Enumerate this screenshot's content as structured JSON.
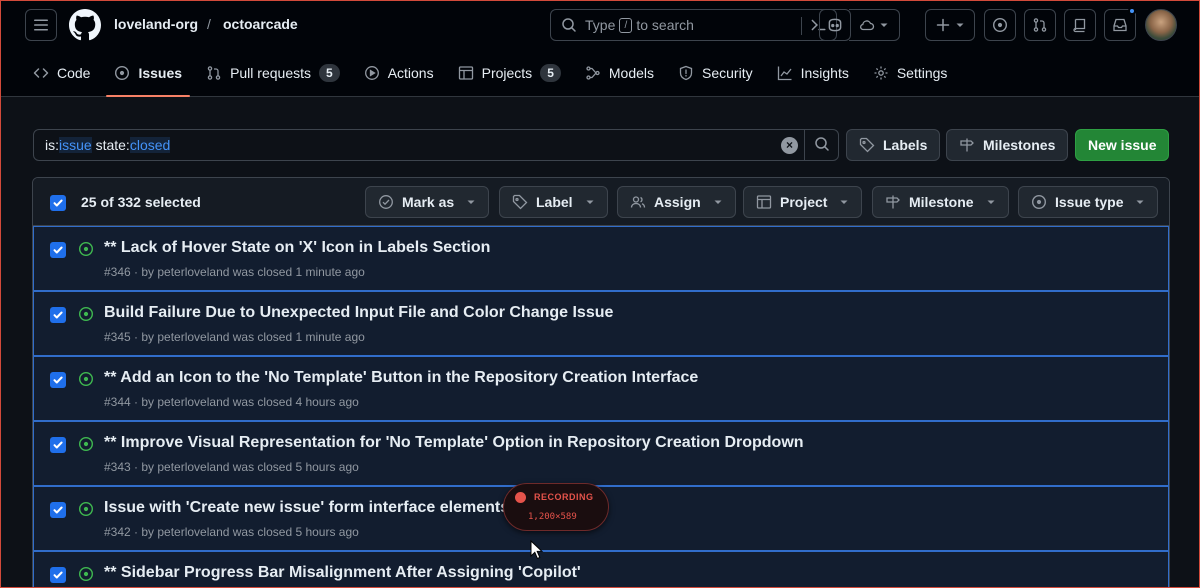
{
  "header": {
    "owner": "loveland-org",
    "separator": "/",
    "repo": "octoarcade",
    "search_prefix": "Type",
    "search_key": "/",
    "search_suffix": "to search"
  },
  "tabs": [
    {
      "label": "Code",
      "icon": "code-icon"
    },
    {
      "label": "Issues",
      "icon": "issue-opened-icon",
      "active": true
    },
    {
      "label": "Pull requests",
      "icon": "git-pull-request-icon",
      "count": "5"
    },
    {
      "label": "Actions",
      "icon": "play-icon"
    },
    {
      "label": "Projects",
      "icon": "table-icon",
      "count": "5"
    },
    {
      "label": "Models",
      "icon": "models-icon"
    },
    {
      "label": "Security",
      "icon": "shield-icon"
    },
    {
      "label": "Insights",
      "icon": "graph-icon"
    },
    {
      "label": "Settings",
      "icon": "gear-icon"
    }
  ],
  "filter": {
    "k1": "is:",
    "v1": "issue",
    "k2": " state:",
    "v2": "closed"
  },
  "toolbar": {
    "labels": "Labels",
    "milestones": "Milestones",
    "new_issue": "New issue"
  },
  "bulk": {
    "selected": "25 of 332 selected",
    "mark_as": "Mark as",
    "label": "Label",
    "assign": "Assign",
    "project": "Project",
    "milestone": "Milestone",
    "issue_type": "Issue type"
  },
  "issues": [
    {
      "title": "** Lack of Hover State on 'X' Icon in Labels Section",
      "meta": "#346 · by peterloveland was closed 1 minute ago"
    },
    {
      "title": "Build Failure Due to Unexpected Input File and Color Change Issue",
      "meta": "#345 · by peterloveland was closed 1 minute ago"
    },
    {
      "title": "** Add an Icon to the 'No Template' Button in the Repository Creation Interface",
      "meta": "#344 · by peterloveland was closed 4 hours ago"
    },
    {
      "title": "** Improve Visual Representation for 'No Template' Option in Repository Creation Dropdown",
      "meta": "#343 · by peterloveland was closed 5 hours ago"
    },
    {
      "title": "Issue with 'Create new issue' form interface elements",
      "meta": "#342 · by peterloveland was closed 5 hours ago"
    },
    {
      "title": "** Sidebar Progress Bar Misalignment After Assigning 'Copilot'",
      "meta": ""
    }
  ],
  "recording": {
    "label": "RECORDING",
    "size": "1,200×589"
  },
  "colors": {
    "accent": "#1f6feb",
    "success": "#238636",
    "state_closed_icon": "#3fb950",
    "selected_row": "#121d2f",
    "active_tab_underline": "#f78166"
  }
}
